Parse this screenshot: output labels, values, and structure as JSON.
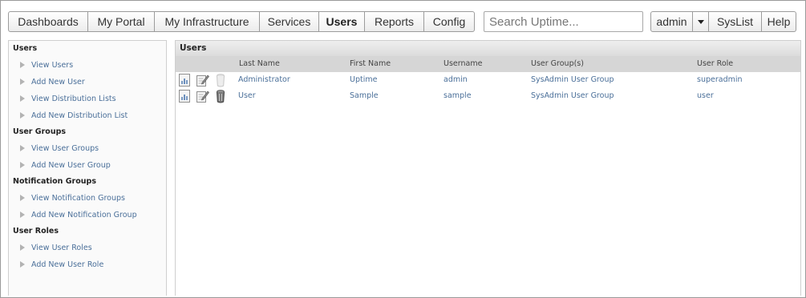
{
  "nav": {
    "tabs": [
      {
        "label": "Dashboards"
      },
      {
        "label": "My Portal"
      },
      {
        "label": "My Infrastructure"
      },
      {
        "label": "Services"
      },
      {
        "label": "Users"
      },
      {
        "label": "Reports"
      },
      {
        "label": "Config"
      }
    ],
    "active_tab": "Users",
    "search_placeholder": "Search Uptime...",
    "user_label": "admin",
    "syslist_label": "SysList",
    "help_label": "Help"
  },
  "sidebar": {
    "sections": [
      {
        "title": "Users",
        "items": [
          {
            "label": "View Users"
          },
          {
            "label": "Add New User"
          },
          {
            "label": "View Distribution Lists"
          },
          {
            "label": "Add New Distribution List"
          }
        ]
      },
      {
        "title": "User Groups",
        "items": [
          {
            "label": "View User Groups"
          },
          {
            "label": "Add New User Group"
          }
        ]
      },
      {
        "title": "Notification Groups",
        "items": [
          {
            "label": "View Notification Groups"
          },
          {
            "label": "Add New Notification Group"
          }
        ]
      },
      {
        "title": "User Roles",
        "items": [
          {
            "label": "View User Roles"
          },
          {
            "label": "Add New User Role"
          }
        ]
      }
    ]
  },
  "main": {
    "title": "Users",
    "columns": {
      "last_name": "Last Name",
      "first_name": "First Name",
      "username": "Username",
      "groups": "User Group(s)",
      "role": "User Role"
    },
    "rows": [
      {
        "last_name": "Administrator",
        "first_name": "Uptime",
        "username": "admin",
        "groups": "SysAdmin User Group",
        "role": "superadmin",
        "delete_enabled": false
      },
      {
        "last_name": "User",
        "first_name": "Sample",
        "username": "sample",
        "groups": "SysAdmin User Group",
        "role": "user",
        "delete_enabled": true
      }
    ]
  },
  "colors": {
    "link": "#4a6f99",
    "header_bg": "#d6d6d6",
    "sidebar_bg": "#fafafa"
  }
}
